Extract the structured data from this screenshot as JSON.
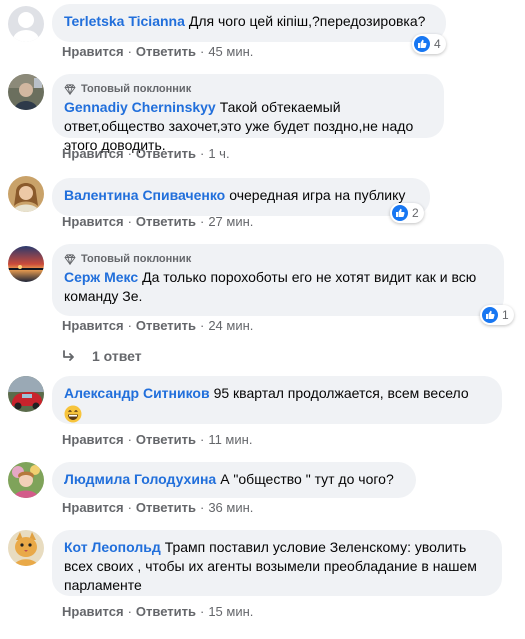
{
  "labels": {
    "like": "Нравится",
    "reply": "Ответить",
    "top_fan": "Топовый поклонник"
  },
  "comments": [
    {
      "author": "Terletska Ticianna",
      "text": "Для чого цей кіпіш,?передозировка?",
      "time": "45 мин.",
      "reactions": "4"
    },
    {
      "author": "Gennadiy Cherninskyy",
      "text": "Такой обтекаемый ответ,общество захочет,это уже будет поздно,не надо этого доводить.",
      "time": "1 ч."
    },
    {
      "author": "Валентина Спиваченко",
      "text": "очередная игра на публику",
      "time": "27 мин.",
      "reactions": "2"
    },
    {
      "author": "Серж Мекс",
      "text": "Да только порохоботы его не хотят видит как и всю команду Зе.",
      "time": "24 мин.",
      "reactions": "1",
      "replies": "1 ответ"
    },
    {
      "author": "Александр Ситников",
      "text": "95 квартал продолжается, всем весело",
      "emoji": "😄",
      "time": "11 мин."
    },
    {
      "author": "Людмила Голодухина",
      "text": "А \"общество \" тут до чого?",
      "time": "36 мин."
    },
    {
      "author": "Кот Леопольд",
      "text": "Трамп поставил условие Зеленскому: уволить всех своих , чтобы их агенты возымели преобладание в нашем парламенте",
      "time": "15 мин."
    }
  ],
  "icons": [
    "avatar",
    "diamond-icon",
    "like-icon",
    "reply-arrow-icon",
    "grin-emoji"
  ],
  "colors": {
    "author": "#216fdb",
    "like": "#1877f2",
    "bubble": "#f0f2f5",
    "meta": "#65676b"
  }
}
